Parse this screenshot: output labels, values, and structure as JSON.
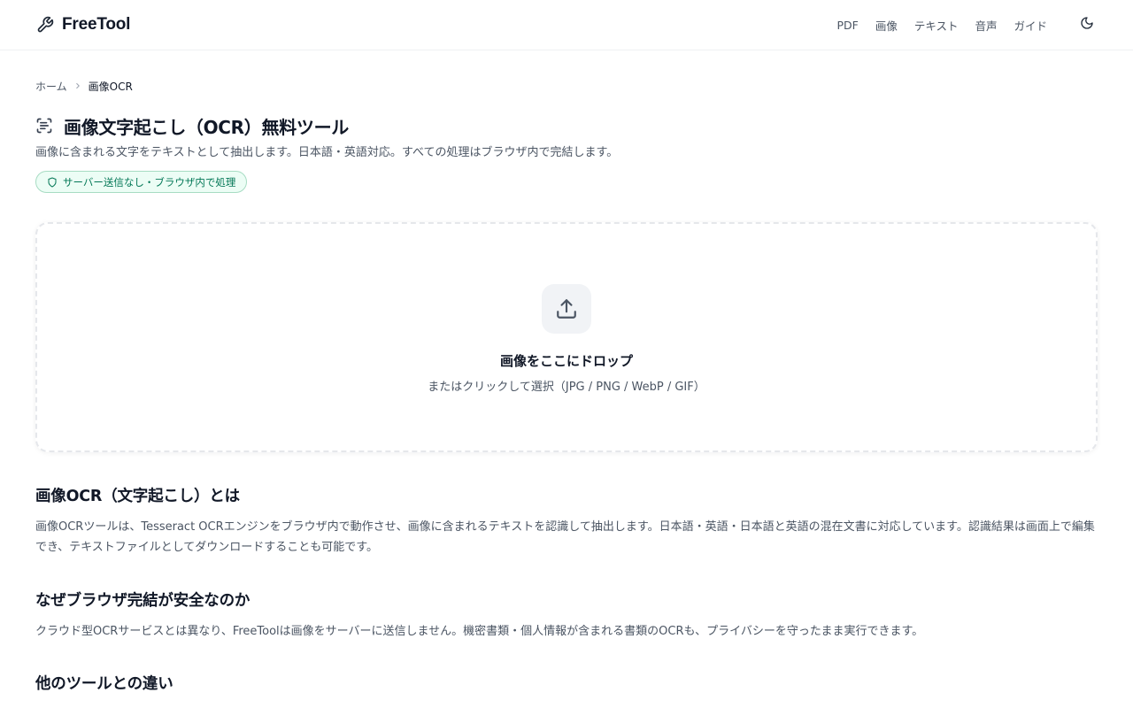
{
  "header": {
    "brand": "FreeTool",
    "nav": [
      "PDF",
      "画像",
      "テキスト",
      "音声",
      "ガイド"
    ]
  },
  "breadcrumb": {
    "home": "ホーム",
    "current": "画像OCR"
  },
  "page": {
    "title": "画像文字起こし（OCR）無料ツール",
    "subtitle": "画像に含まれる文字をテキストとして抽出します。日本語・英語対応。すべての処理はブラウザ内で完結します。",
    "badge": "サーバー送信なし・ブラウザ内で処理"
  },
  "dropzone": {
    "title": "画像をここにドロップ",
    "subtitle": "またはクリックして選択（JPG / PNG / WebP / GIF）"
  },
  "sections": [
    {
      "heading": "画像OCR（文字起こし）とは",
      "body": "画像OCRツールは、Tesseract OCRエンジンをブラウザ内で動作させ、画像に含まれるテキストを認識して抽出します。日本語・英語・日本語と英語の混在文書に対応しています。認識結果は画面上で編集でき、テキストファイルとしてダウンロードすることも可能です。"
    },
    {
      "heading": "なぜブラウザ完結が安全なのか",
      "body": "クラウド型OCRサービスとは異なり、FreeToolは画像をサーバーに送信しません。機密書類・個人情報が含まれる書類のOCRも、プライバシーを守ったまま実行できます。"
    },
    {
      "heading": "他のツールとの違い"
    }
  ],
  "icons": {
    "brand": "wrench-icon",
    "theme": "moon-icon",
    "breadcrumb_separator": "chevron-right-icon",
    "title": "scan-text-icon",
    "badge": "shield-icon",
    "upload": "upload-icon"
  },
  "colors": {
    "badge_text": "#047857",
    "badge_bg": "#ecfdf5",
    "badge_border": "#a7dcc3"
  }
}
